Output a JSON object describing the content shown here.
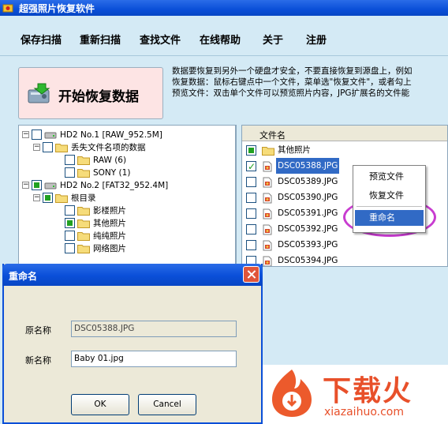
{
  "window": {
    "title": "超强照片恢复软件"
  },
  "menu": [
    "保存扫描",
    "重新扫描",
    "查找文件",
    "在线帮助",
    "关于",
    "注册"
  ],
  "restore_button": {
    "label": "开始恢复数据"
  },
  "info_lines": [
    "数据要恢复到另外一个硬盘才安全，不要直接恢复到源盘上，例如",
    "恢复数据：鼠标右键点中一个文件，菜单选\"恢复文件\"，或者勾上",
    "预览文件：双击单个文件可以预览照片内容，JPG扩展名的文件能"
  ],
  "tree": [
    {
      "label": "HD2 No.1 [RAW_952.5M]",
      "expander": "−",
      "check": "empty",
      "icon": "drive-icon"
    },
    {
      "label": "丢失文件名项的数据",
      "expander": "−",
      "check": "empty",
      "icon": "folder-icon"
    },
    {
      "label": "RAW (6)",
      "expander": "",
      "check": "empty",
      "icon": "folder-icon"
    },
    {
      "label": "SONY (1)",
      "expander": "",
      "check": "empty",
      "icon": "folder-icon"
    },
    {
      "label": "HD2 No.2 [FAT32_952.4M]",
      "expander": "−",
      "check": "partial",
      "icon": "drive-icon"
    },
    {
      "label": "根目录",
      "expander": "−",
      "check": "partial",
      "icon": "folder-icon"
    },
    {
      "label": "影楼照片",
      "expander": "",
      "check": "empty",
      "icon": "folder-icon"
    },
    {
      "label": "其他照片",
      "expander": "",
      "check": "partial",
      "icon": "folder-icon"
    },
    {
      "label": "纯纯照片",
      "expander": "",
      "check": "empty",
      "icon": "folder-icon"
    },
    {
      "label": "网络图片",
      "expander": "",
      "check": "empty",
      "icon": "folder-icon"
    }
  ],
  "file_list": {
    "header": "文件名",
    "items": [
      {
        "name": "其他照片",
        "check": "partial",
        "icon": "folder-icon"
      },
      {
        "name": "DSC05388.JPG",
        "check": "checked",
        "icon": "image-file-icon",
        "selected": true
      },
      {
        "name": "DSC05389.JPG",
        "check": "empty",
        "icon": "image-file-icon"
      },
      {
        "name": "DSC05390.JPG",
        "check": "empty",
        "icon": "image-file-icon"
      },
      {
        "name": "DSC05391.JPG",
        "check": "empty",
        "icon": "image-file-icon"
      },
      {
        "name": "DSC05392.JPG",
        "check": "empty",
        "icon": "image-file-icon"
      },
      {
        "name": "DSC05393.JPG",
        "check": "empty",
        "icon": "image-file-icon"
      },
      {
        "name": "DSC05394.JPG",
        "check": "empty",
        "icon": "image-file-icon"
      }
    ]
  },
  "context_menu": [
    {
      "label": "预览文件"
    },
    {
      "label": "恢复文件"
    },
    {
      "label": "重命名",
      "highlighted": true
    }
  ],
  "dialog": {
    "title": "重命名",
    "original_label": "原名称",
    "original_value": "DSC05388.JPG",
    "new_label": "新名称",
    "new_value": "Baby 01.jpg",
    "ok_label": "OK",
    "cancel_label": "Cancel"
  },
  "watermark": {
    "text": "下载火",
    "url": "xiazaihuo.com"
  },
  "colors": {
    "titlebar": "#0a4fd8",
    "app_bg": "#d4eaf5",
    "selection": "#316ac5",
    "highlight_ring": "#c83cd0",
    "watermark": "#e8502a"
  }
}
